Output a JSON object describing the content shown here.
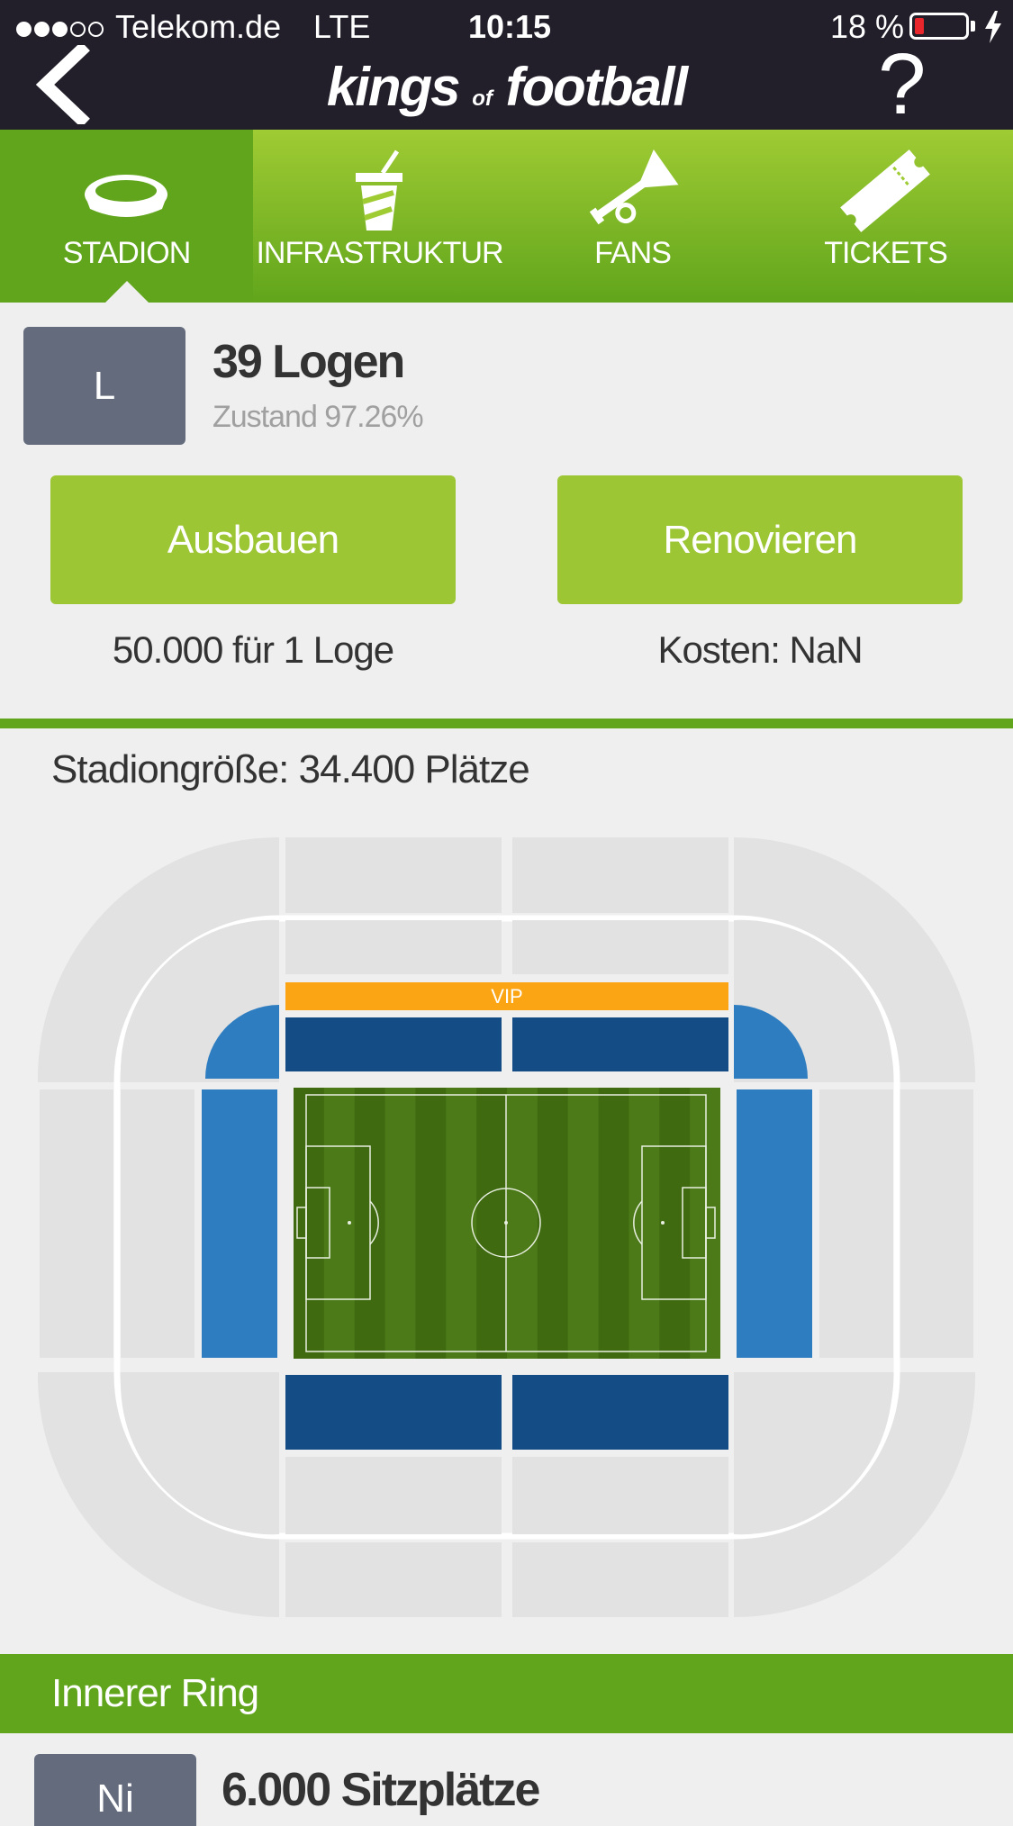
{
  "status_bar": {
    "carrier": "Telekom.de",
    "network": "LTE",
    "time": "10:15",
    "battery": "18 %",
    "battery_level": 0.18,
    "signal_bars_filled": 3,
    "signal_bars_total": 5
  },
  "header": {
    "logo_main": "kings",
    "logo_of": "of",
    "logo_end": "football",
    "help_label": "?",
    "back_icon": "chevron-left-icon"
  },
  "tabs": [
    {
      "label": "STADION",
      "icon": "stadium-icon",
      "active": true
    },
    {
      "label": "INFRASTRUKTUR",
      "icon": "drink-cup-icon",
      "active": false
    },
    {
      "label": "FANS",
      "icon": "trumpet-icon",
      "active": false
    },
    {
      "label": "TICKETS",
      "icon": "ticket-icon",
      "active": false
    }
  ],
  "item": {
    "tile_letter": "L",
    "title": "39 Logen",
    "condition": "Zustand 97.26%"
  },
  "actions": {
    "upgrade_label": "Ausbauen",
    "upgrade_cost": "50.000 für 1 Loge",
    "renovate_label": "Renovieren",
    "renovate_cost": "Kosten: NaN"
  },
  "stadium": {
    "size_label": "Stadiongröße: 34.400 Plätze",
    "vip_label": "VIP"
  },
  "section": {
    "title": "Innerer Ring",
    "next_tile_letter": "Ni",
    "next_title": "6.000 Sitzplätze"
  },
  "colors": {
    "header_bg": "#221e2a",
    "green_light": "#9fcb33",
    "green_dark": "#61a51c",
    "button_green": "#9dc635",
    "tile_gray": "#636b7d",
    "vip_orange": "#fba514",
    "seat_dark_blue": "#144d86",
    "seat_blue": "#2e7dc0",
    "pitch_green": "#3f6a10",
    "ring_gray": "#e2e2e2"
  }
}
